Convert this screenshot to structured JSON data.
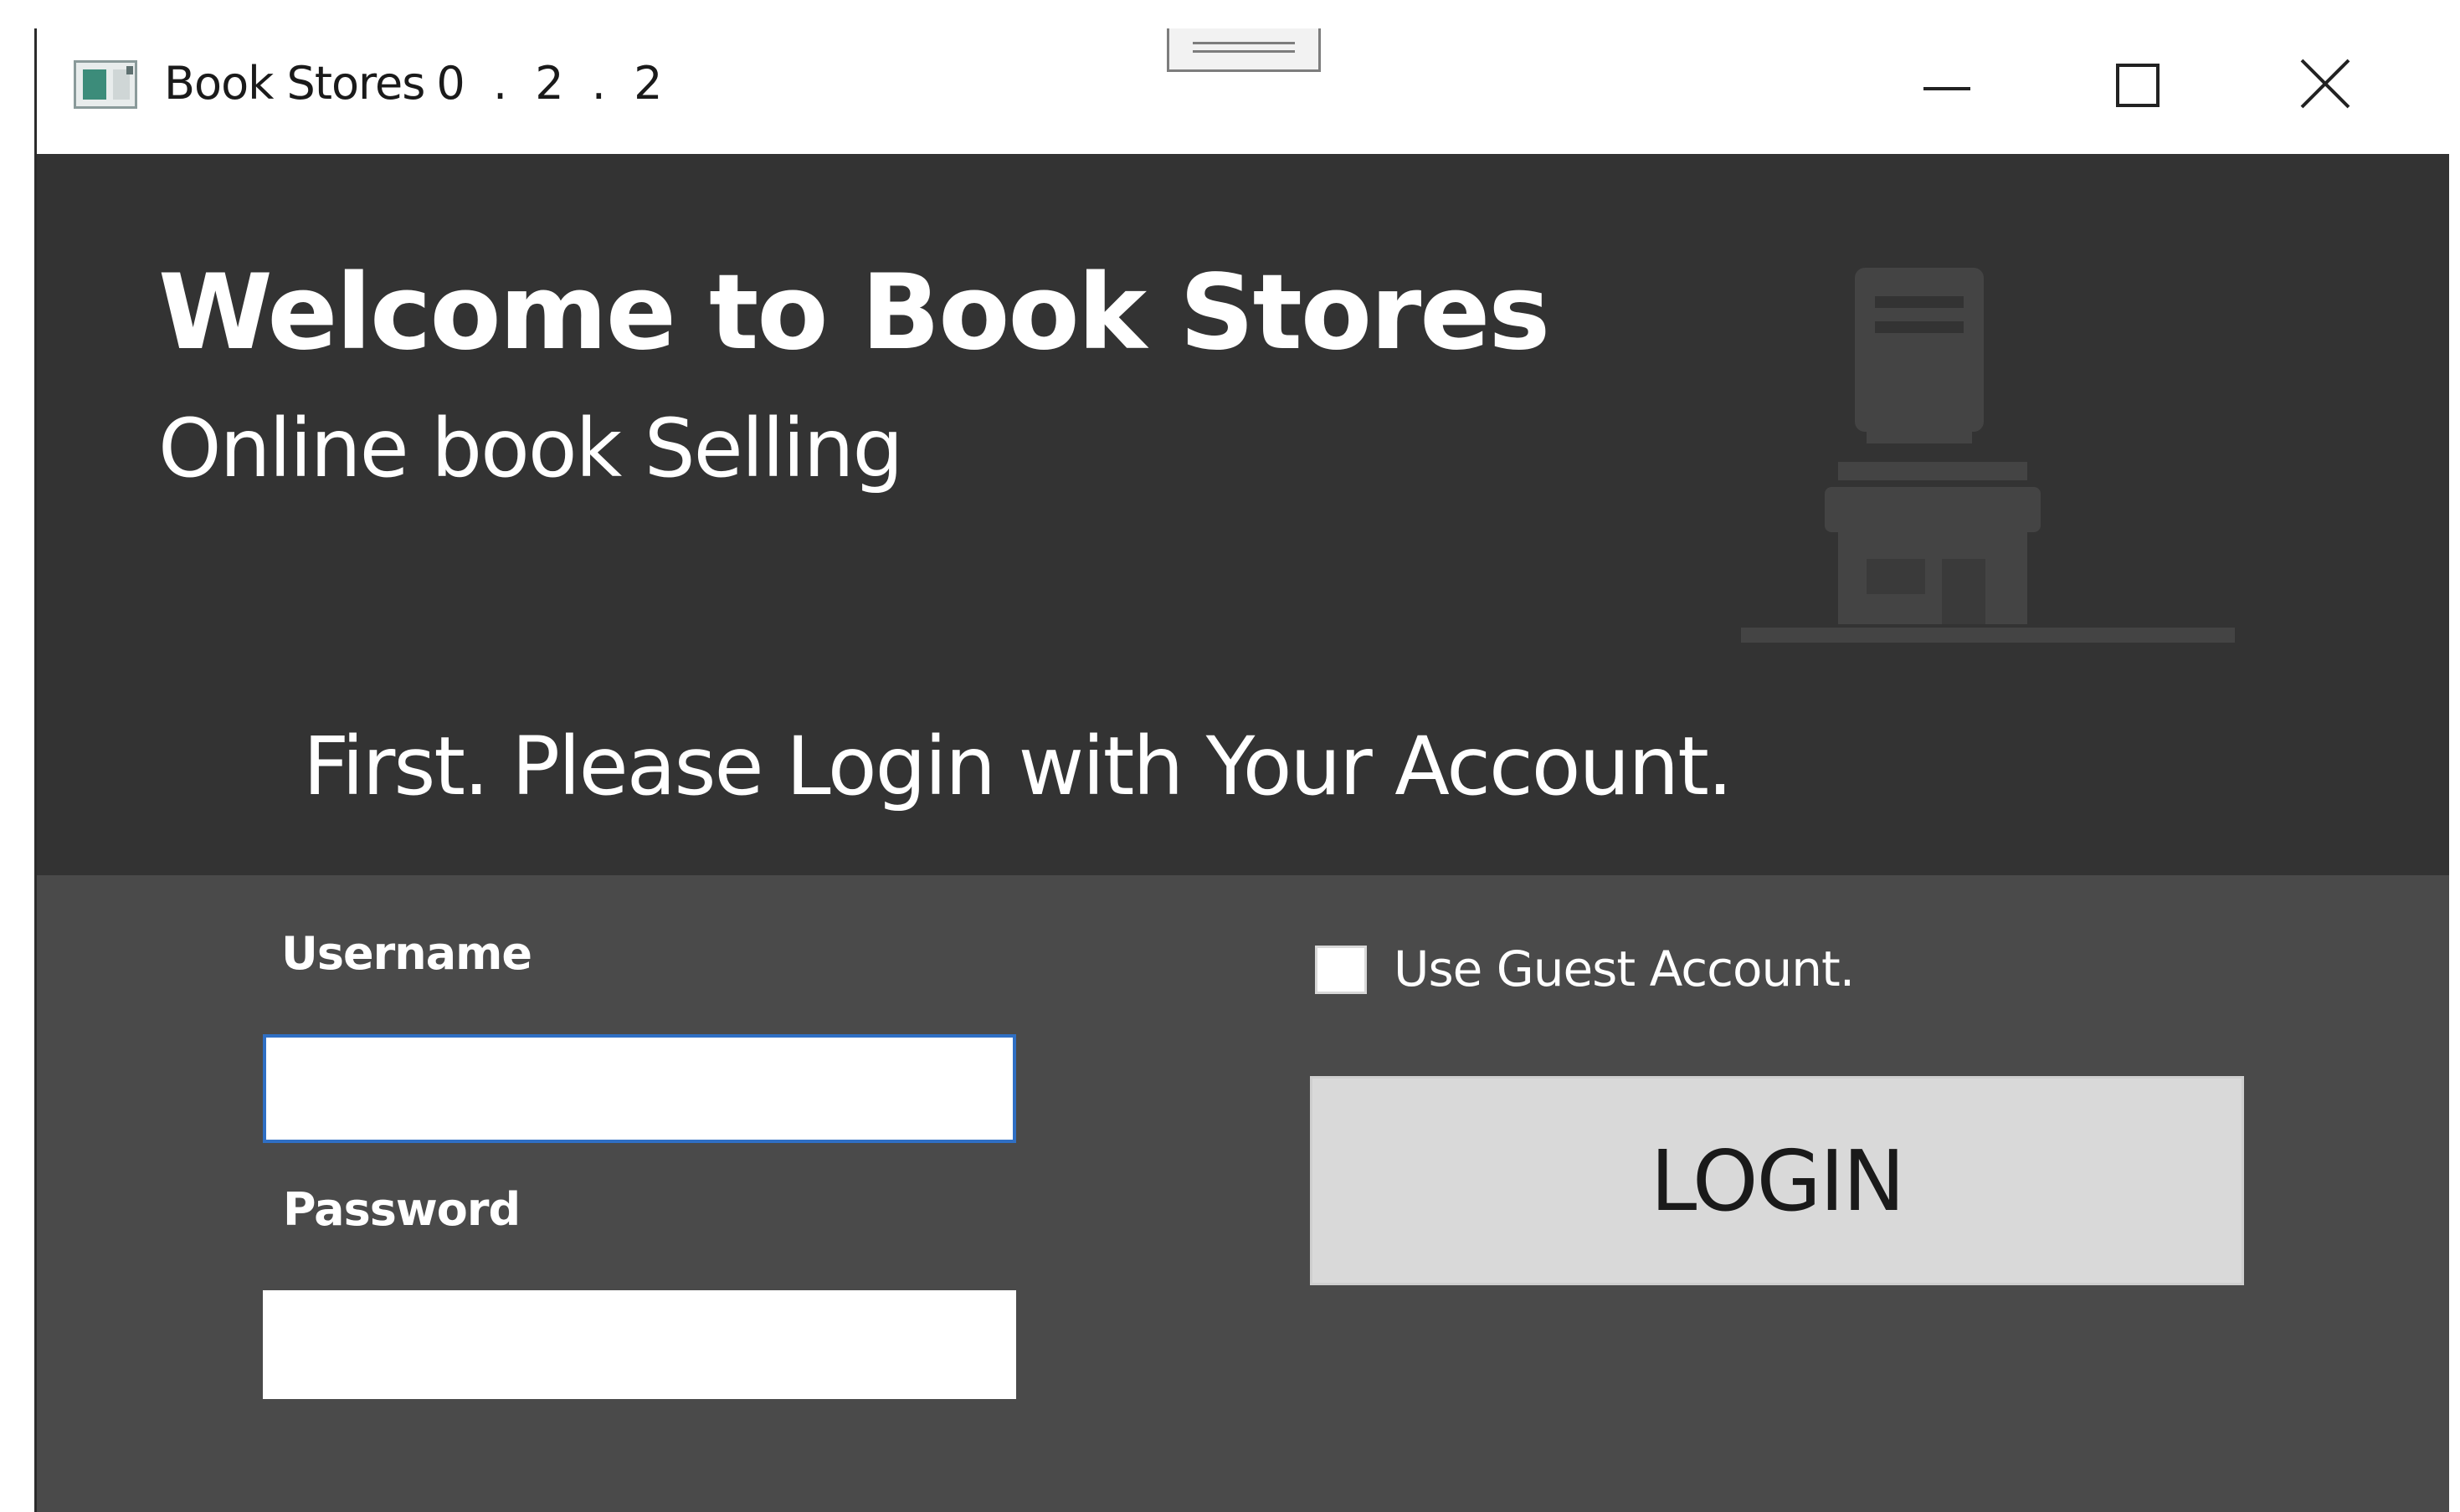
{
  "window": {
    "title": "Book Stores",
    "version": "0 . 2 . 2"
  },
  "header": {
    "welcome": "Welcome to Book Stores",
    "subtitle": "Online book Selling",
    "instruction": "First. Please Login with Your Account."
  },
  "form": {
    "username_label": "Username",
    "username_value": "",
    "password_label": "Password",
    "password_value": "",
    "guest_label": "Use Guest Account.",
    "guest_checked": false,
    "login_label": "LOGIN"
  },
  "icons": {
    "app": "app-icon",
    "store": "store-icon",
    "minimize": "minimize-icon",
    "maximize": "maximize-icon",
    "close": "close-icon"
  },
  "colors": {
    "header_bg": "#333333",
    "form_bg": "#4a4a4a",
    "login_bg": "#d9d9d9",
    "focus_border": "#2f6fc4",
    "store_icon": "#444444"
  }
}
